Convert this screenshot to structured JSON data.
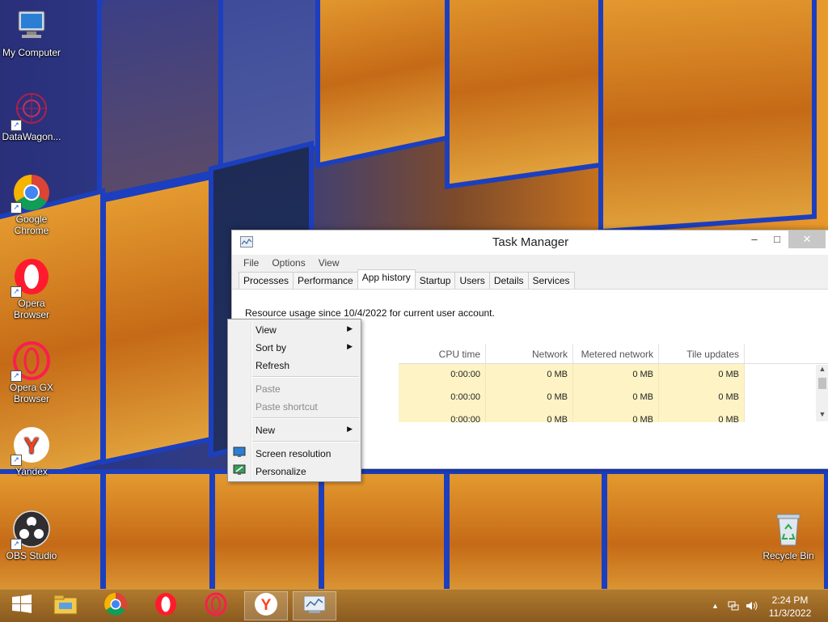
{
  "desktop": {
    "icons": [
      {
        "label": "My Computer",
        "icon": "computer-icon"
      },
      {
        "label": "DataWagon...",
        "icon": "datawagon-icon"
      },
      {
        "label": "Google Chrome",
        "icon": "chrome-icon"
      },
      {
        "label": "Opera Browser",
        "icon": "opera-icon"
      },
      {
        "label": "Opera GX Browser",
        "icon": "opera-gx-icon"
      },
      {
        "label": "Yandex",
        "icon": "yandex-icon"
      },
      {
        "label": "OBS Studio",
        "icon": "obs-icon"
      },
      {
        "label": "Recycle Bin",
        "icon": "recycle-bin-icon"
      }
    ]
  },
  "task_manager": {
    "title": "Task Manager",
    "menu": [
      "File",
      "Options",
      "View"
    ],
    "tabs": [
      "Processes",
      "Performance",
      "App history",
      "Startup",
      "Users",
      "Details",
      "Services"
    ],
    "active_tab": "App history",
    "resource_text": "Resource usage since 10/4/2022 for current user account.",
    "columns": [
      "CPU time",
      "Network",
      "Metered network",
      "Tile updates"
    ],
    "rows": [
      [
        "0:00:00",
        "0 MB",
        "0 MB",
        "0 MB"
      ],
      [
        "0:00:00",
        "0 MB",
        "0 MB",
        "0 MB"
      ],
      [
        "0:00:00",
        "0 MB",
        "0 MB",
        "0 MB"
      ]
    ]
  },
  "context_menu": {
    "items": [
      {
        "label": "View",
        "submenu": true,
        "disabled": false
      },
      {
        "label": "Sort by",
        "submenu": true,
        "disabled": false
      },
      {
        "label": "Refresh",
        "submenu": false,
        "disabled": false
      },
      {
        "label": "Paste",
        "submenu": false,
        "disabled": true
      },
      {
        "label": "Paste shortcut",
        "submenu": false,
        "disabled": true
      },
      {
        "label": "New",
        "submenu": true,
        "disabled": false
      },
      {
        "label": "Screen resolution",
        "submenu": false,
        "disabled": false
      },
      {
        "label": "Personalize",
        "submenu": false,
        "disabled": false
      }
    ]
  },
  "taskbar": {
    "clock_time": "2:24 PM",
    "clock_date": "11/3/2022",
    "pinned": [
      "start-icon",
      "file-explorer-icon",
      "chrome-icon",
      "opera-icon",
      "opera-gx-icon",
      "yandex-icon",
      "task-manager-icon"
    ]
  },
  "colors": {
    "wall_frame": "#1c3fbf",
    "wall_glass": "#e49a2f",
    "grid_highlight": "#fdf3c5",
    "taskbar": "#8a5a1f"
  }
}
